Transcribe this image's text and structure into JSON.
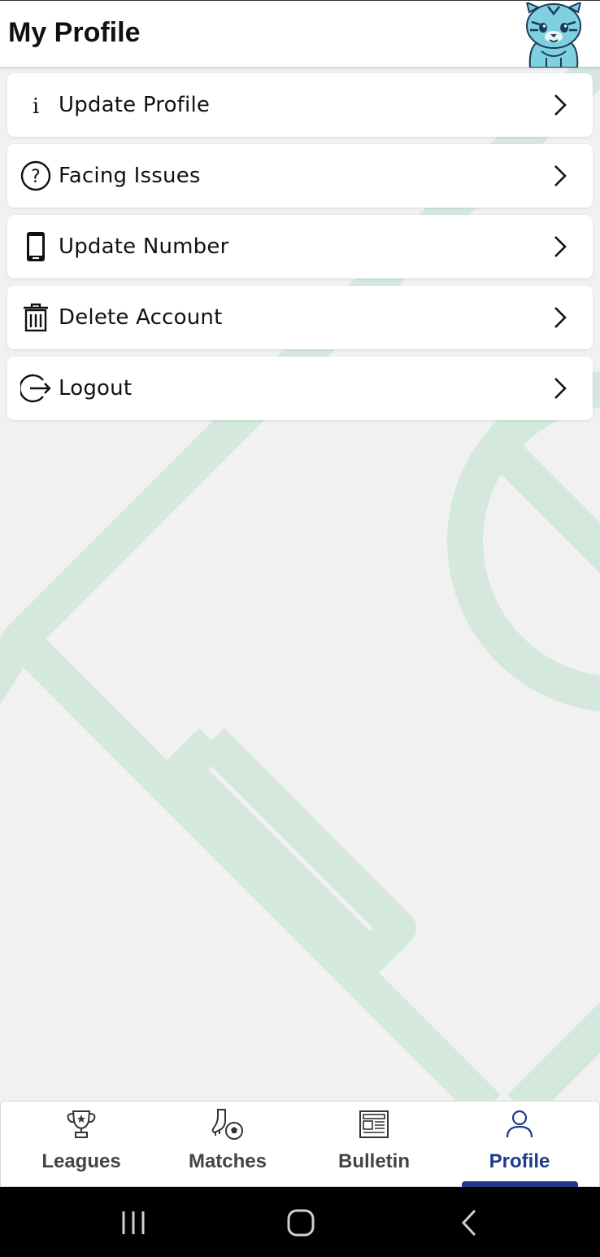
{
  "header": {
    "title": "My Profile",
    "mascot_icon": "tiger-mascot-icon"
  },
  "menu": {
    "items": [
      {
        "label": "Update Profile",
        "icon": "info-icon"
      },
      {
        "label": "Facing Issues",
        "icon": "question-circle-icon"
      },
      {
        "label": "Update Number",
        "icon": "phone-icon"
      },
      {
        "label": "Delete Account",
        "icon": "trash-icon"
      },
      {
        "label": "Logout",
        "icon": "logout-icon"
      }
    ]
  },
  "tabs": {
    "items": [
      {
        "label": "Leagues",
        "icon": "trophy-icon"
      },
      {
        "label": "Matches",
        "icon": "football-boot-icon"
      },
      {
        "label": "Bulletin",
        "icon": "newspaper-icon"
      },
      {
        "label": "Profile",
        "icon": "user-icon"
      }
    ],
    "active": "Profile"
  },
  "system_nav": {
    "buttons": [
      "recent-apps-icon",
      "home-icon",
      "back-icon"
    ]
  },
  "colors": {
    "accent": "#1f3a8c",
    "background": "#f1f1f1",
    "pitch_lines": "#d4e8de",
    "mascot": "#7fd0e0"
  }
}
